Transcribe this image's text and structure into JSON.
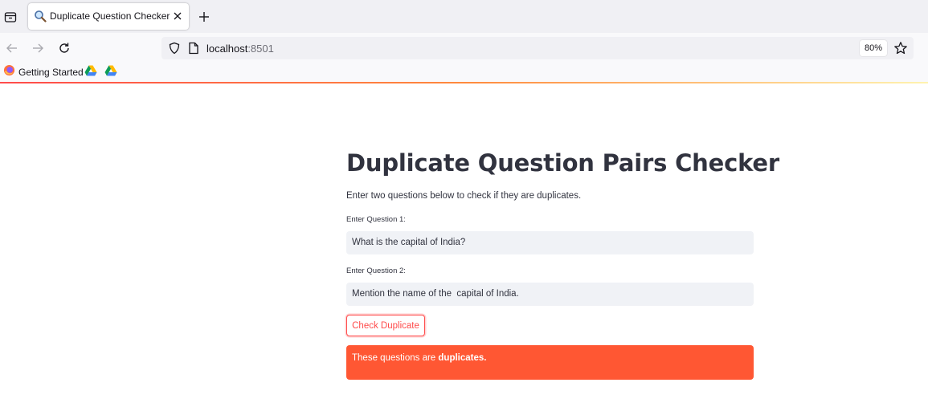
{
  "browser": {
    "tab": {
      "title": "Duplicate Question Checker",
      "favicon": "magnifier-icon"
    },
    "url": {
      "host": "localhost",
      "port": ":8501"
    },
    "zoom": "80%",
    "bookmarks": [
      {
        "label": "Getting Started",
        "icon": "firefox-icon"
      },
      {
        "label": "",
        "icon": "google-drive-icon"
      },
      {
        "label": "",
        "icon": "google-drive-icon"
      }
    ]
  },
  "page": {
    "title": "Duplicate Question Pairs Checker",
    "subtitle": "Enter two questions below to check if they are duplicates.",
    "question1": {
      "label": "Enter Question 1:",
      "value": "What is the capital of India?"
    },
    "question2": {
      "label": "Enter Question 2:",
      "value": "Mention the name of the  capital of India."
    },
    "check_button_label": "Check Duplicate",
    "result": {
      "prefix": "These questions are ",
      "emphasis": "duplicates",
      "suffix": "."
    }
  },
  "colors": {
    "accent": "#ff4b4b",
    "alert_bg": "#ff5733",
    "text": "#31333f",
    "input_bg": "#f0f2f6"
  }
}
